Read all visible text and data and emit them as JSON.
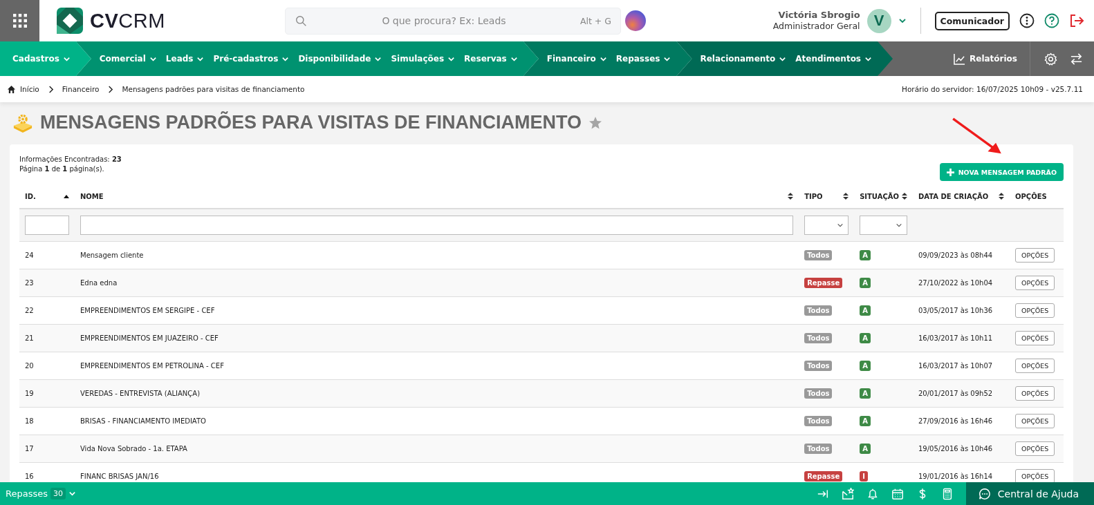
{
  "logo": {
    "bold": "CV",
    "light": "CRM"
  },
  "search": {
    "placeholder": "O que procura? Ex: Leads",
    "shortcut": "Alt + G"
  },
  "user": {
    "name": "Victória Sbrogio",
    "role": "Administrador Geral",
    "initial": "V"
  },
  "communicator_button": "Comunicador",
  "nav": [
    {
      "items": [
        "Cadastros"
      ]
    },
    {
      "items": [
        "Comercial",
        "Leads",
        "Pré-cadastros",
        "Disponibilidade",
        "Simulações",
        "Reservas"
      ]
    },
    {
      "items": [
        "Financeiro",
        "Repasses"
      ]
    },
    {
      "items": [
        "Relacionamento",
        "Atendimentos"
      ]
    }
  ],
  "reports": "Relatórios",
  "breadcrumb": [
    "Início",
    "Financeiro",
    "Mensagens padrões para visitas de financiamento"
  ],
  "server_time": "Horário do servidor: 16/07/2025 10h09 - v25.7.11",
  "page_title": "MENSAGENS PADRÕES PARA VISITAS DE FINANCIAMENTO",
  "favorite": false,
  "summary": [
    "Informações Encontradas: **23**",
    "Página **1** de **1** página(s)."
  ],
  "new_button": "NOVA MENSAGEM PADRÃO",
  "table": {
    "columns": [
      {
        "label": "ID.",
        "kind": "ascending"
      },
      {
        "label": "NOME",
        "kind": "sortable"
      },
      {
        "label": "TIPO",
        "kind": "sortable"
      },
      {
        "label": "SITUAÇÃO",
        "kind": "sortable"
      },
      {
        "label": "DATA DE CRIAÇÃO",
        "kind": "sortable"
      },
      {
        "label": "OPÇÕES",
        "kind": "plain"
      }
    ],
    "filters": [
      {
        "kind": "text"
      },
      {
        "kind": "text"
      },
      {
        "kind": "select"
      },
      {
        "kind": "select"
      },
      {
        "kind": "empty"
      },
      {
        "kind": "empty"
      }
    ],
    "rows": [
      {
        "id": "24",
        "name": "Mensagem cliente",
        "type": {
          "label": "Todos",
          "color": "#999999"
        },
        "status": {
          "label": "A",
          "color": "#3e8a46"
        },
        "created": "09/09/2023 às 08h44",
        "options": "OPÇÕES"
      },
      {
        "id": "23",
        "name": "Edna edna",
        "type": {
          "label": "Repasse",
          "color": "#c64140"
        },
        "status": {
          "label": "A",
          "color": "#3e8a46"
        },
        "created": "27/10/2022 às 10h04",
        "options": "OPÇÕES"
      },
      {
        "id": "22",
        "name": "EMPREENDIMENTOS EM SERGIPE - CEF",
        "type": {
          "label": "Todos",
          "color": "#999999"
        },
        "status": {
          "label": "A",
          "color": "#3e8a46"
        },
        "created": "03/05/2017 às 10h36",
        "options": "OPÇÕES"
      },
      {
        "id": "21",
        "name": "EMPREENDIMENTOS EM JUAZEIRO - CEF",
        "type": {
          "label": "Todos",
          "color": "#999999"
        },
        "status": {
          "label": "A",
          "color": "#3e8a46"
        },
        "created": "16/03/2017 às 10h11",
        "options": "OPÇÕES"
      },
      {
        "id": "20",
        "name": "EMPREENDIMENTOS EM PETROLINA - CEF",
        "type": {
          "label": "Todos",
          "color": "#999999"
        },
        "status": {
          "label": "A",
          "color": "#3e8a46"
        },
        "created": "16/03/2017 às 10h07",
        "options": "OPÇÕES"
      },
      {
        "id": "19",
        "name": "VEREDAS - ENTREVISTA (ALIANÇA)",
        "type": {
          "label": "Todos",
          "color": "#999999"
        },
        "status": {
          "label": "A",
          "color": "#3e8a46"
        },
        "created": "20/01/2017 às 09h52",
        "options": "OPÇÕES"
      },
      {
        "id": "18",
        "name": "BRISAS - FINANCIAMENTO IMEDIATO",
        "type": {
          "label": "Todos",
          "color": "#999999"
        },
        "status": {
          "label": "A",
          "color": "#3e8a46"
        },
        "created": "27/09/2016 às 16h46",
        "options": "OPÇÕES"
      },
      {
        "id": "17",
        "name": "Vida Nova Sobrado - 1a. ETAPA",
        "type": {
          "label": "Todos",
          "color": "#999999"
        },
        "status": {
          "label": "A",
          "color": "#3e8a46"
        },
        "created": "19/05/2016 às 10h46",
        "options": "OPÇÕES"
      },
      {
        "id": "16",
        "name": "FINANC BRISAS JAN/16",
        "type": {
          "label": "Repasse",
          "color": "#c64140"
        },
        "status": {
          "label": "I",
          "color": "#c64140"
        },
        "created": "19/01/2016 às 16h14",
        "options": "OPÇÕES"
      }
    ]
  },
  "bottom_bar": {
    "label": "Repasses",
    "count": "30",
    "help": "Central de Ajuda"
  }
}
